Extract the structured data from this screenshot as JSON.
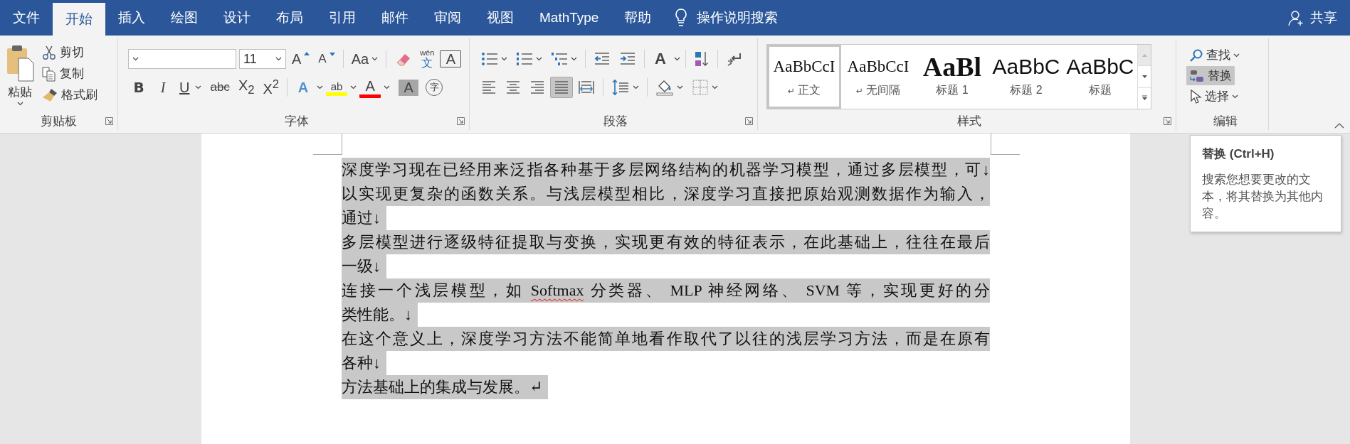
{
  "tabs": [
    {
      "label": "文件",
      "selected": false
    },
    {
      "label": "开始",
      "selected": true
    },
    {
      "label": "插入",
      "selected": false
    },
    {
      "label": "绘图",
      "selected": false
    },
    {
      "label": "设计",
      "selected": false
    },
    {
      "label": "布局",
      "selected": false
    },
    {
      "label": "引用",
      "selected": false
    },
    {
      "label": "邮件",
      "selected": false
    },
    {
      "label": "审阅",
      "selected": false
    },
    {
      "label": "视图",
      "selected": false
    },
    {
      "label": "MathType",
      "selected": false
    },
    {
      "label": "帮助",
      "selected": false
    }
  ],
  "tell_me": {
    "placeholder": "操作说明搜索"
  },
  "share": {
    "label": "共享"
  },
  "ribbon": {
    "clipboard": {
      "label": "剪贴板",
      "paste": "粘贴",
      "items": [
        {
          "label": "剪切",
          "kind": "cut"
        },
        {
          "label": "复制",
          "kind": "copy"
        },
        {
          "label": "格式刷",
          "kind": "painter"
        }
      ]
    },
    "font": {
      "label": "字体",
      "font_size": "11",
      "grow": "A",
      "shrink": "A",
      "change_case": "Aa",
      "phonetic_top": "wén",
      "phonetic_bottom": "文",
      "border_char": "A",
      "format": [
        {
          "label": "B",
          "kind": "bold",
          "caret": false
        },
        {
          "label": "I",
          "kind": "italic",
          "caret": false
        },
        {
          "label": "U",
          "kind": "underline",
          "caret": true
        },
        {
          "label": "abc",
          "kind": "strike",
          "caret": false
        },
        {
          "label": "X$_{2}$",
          "kind": "plain",
          "caret": false
        },
        {
          "label": "X$^{2}$",
          "kind": "plain",
          "caret": false
        }
      ],
      "effects": "A",
      "highlight": {
        "label": "ab",
        "color": "#ffff00"
      },
      "font_color": {
        "label": "A",
        "color": "#ff0000"
      },
      "shading": "A",
      "enclose": "字"
    },
    "paragraph": {
      "label": "段落",
      "asian_layout": "A",
      "alignment": [
        {
          "selected": false
        },
        {
          "selected": false
        },
        {
          "selected": false
        },
        {
          "selected": true
        },
        {
          "selected": false
        }
      ]
    },
    "styles": {
      "label": "样式",
      "items": [
        {
          "preview": "AaBbCcI",
          "label": "正文",
          "mark": "↵",
          "kind": "serif",
          "selected": true
        },
        {
          "preview": "AaBbCcI",
          "label": "无间隔",
          "mark": "↵",
          "kind": "serif",
          "selected": false
        },
        {
          "preview": "AaBl",
          "label": "标题 1",
          "kind": "heading",
          "selected": false
        },
        {
          "preview": "AaBbC",
          "label": "标题 2",
          "kind": "sans",
          "selected": false
        },
        {
          "preview": "AaBbC",
          "label": "标题",
          "kind": "sans",
          "selected": false
        }
      ]
    },
    "editing": {
      "label": "编辑",
      "items": [
        {
          "label": "查找",
          "kind": "find",
          "caret": true,
          "hovered": false
        },
        {
          "label": "替换",
          "kind": "replace",
          "caret": false,
          "hovered": true
        },
        {
          "label": "选择",
          "kind": "select",
          "caret": true,
          "hovered": false
        }
      ]
    }
  },
  "document": {
    "selected": true,
    "lines": [
      {
        "kind": "full",
        "segments": [
          {
            "text": "深度学习现在已经用来泛指各种基于多层网络结构的机器学习模型，通过多层模型，可↓",
            "misspelled": false
          }
        ]
      },
      {
        "kind": "full",
        "segments": [
          {
            "text": "以实现更复杂的函数关系。与浅层模型相比，深度学习直接把原始观测数据作为输入，",
            "misspelled": false
          }
        ]
      },
      {
        "kind": "short",
        "segments": [
          {
            "text": "通过↓",
            "misspelled": false
          }
        ]
      },
      {
        "kind": "full",
        "segments": [
          {
            "text": "多层模型进行逐级特征提取与变换，实现更有效的特征表示，在此基础上，往往在最后",
            "misspelled": false
          }
        ]
      },
      {
        "kind": "short",
        "segments": [
          {
            "text": "一级↓",
            "misspelled": false
          }
        ]
      },
      {
        "kind": "full",
        "segments": [
          {
            "text": "连接一个浅层模型，如 ",
            "misspelled": false
          },
          {
            "text": "Softmax",
            "misspelled": true
          },
          {
            "text": " 分类器、 MLP 神经网络、 SVM 等，实现更好的分",
            "misspelled": false
          }
        ]
      },
      {
        "kind": "short",
        "segments": [
          {
            "text": "类性能。↓",
            "misspelled": false
          }
        ]
      },
      {
        "kind": "full",
        "segments": [
          {
            "text": "在这个意义上，深度学习方法不能简单地看作取代了以往的浅层学习方法，而是在原有",
            "misspelled": false
          }
        ]
      },
      {
        "kind": "short",
        "segments": [
          {
            "text": "各种↓",
            "misspelled": false
          }
        ]
      },
      {
        "kind": "short",
        "segments": [
          {
            "text": "方法基础上的集成与发展。↵",
            "misspelled": false
          }
        ]
      }
    ]
  },
  "tooltip": {
    "title": "替换 (Ctrl+H)",
    "text": "搜索您想要更改的文本，将其替换为其他内容。"
  }
}
